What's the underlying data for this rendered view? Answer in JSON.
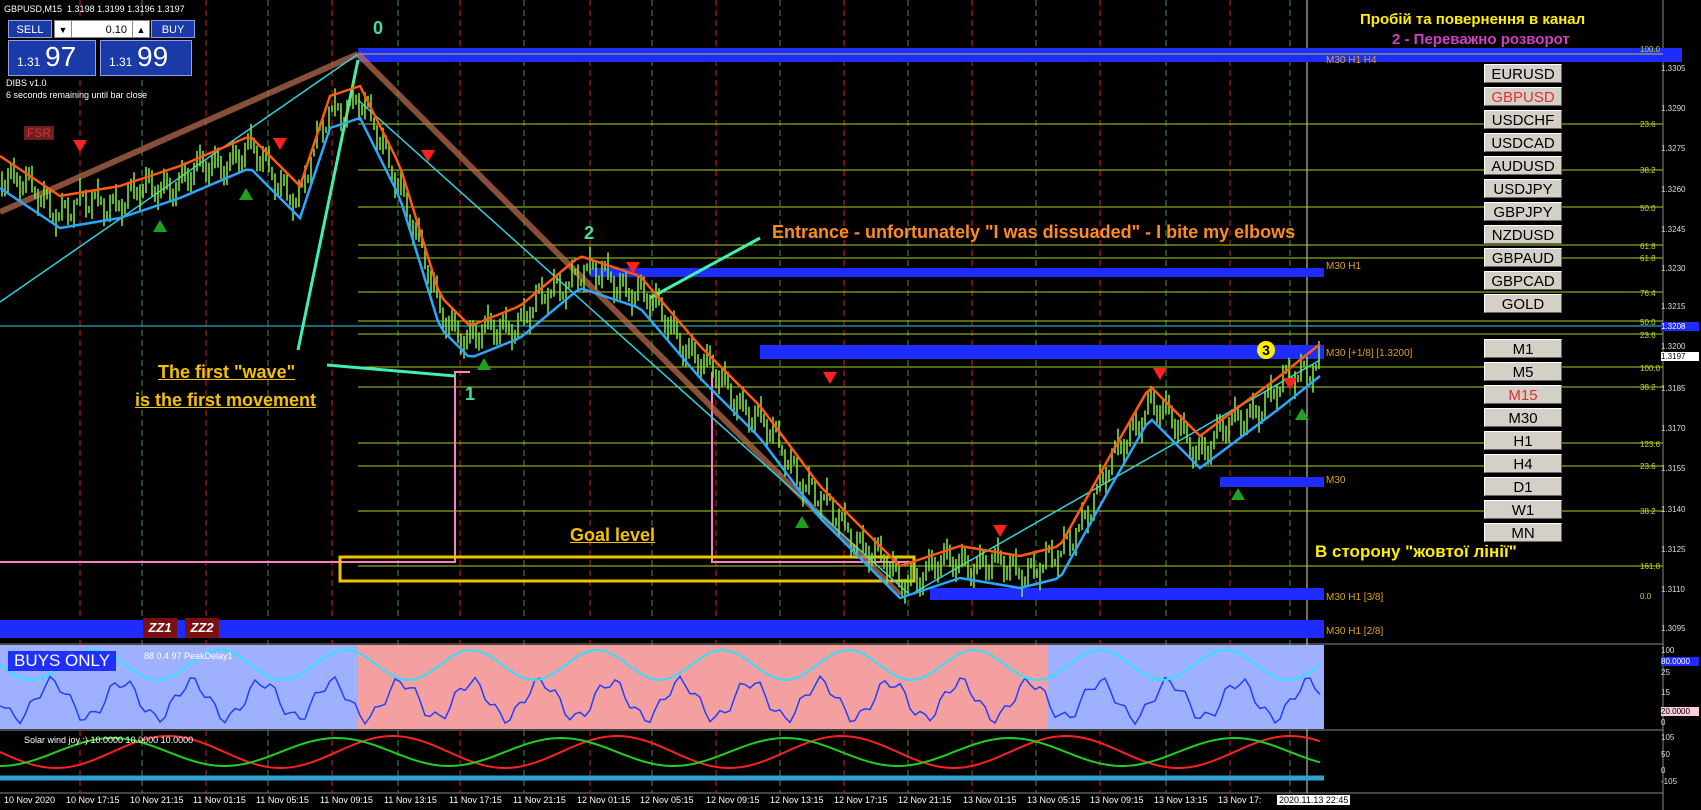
{
  "window": {
    "title": "GBPUSD,M15",
    "ohlc": "1.3198 1.3199 1.3196 1.3197"
  },
  "trade_panel": {
    "sell_label": "SELL",
    "buy_label": "BUY",
    "volume": "0.10",
    "sell_prefix": "1.31",
    "sell_big": "97",
    "buy_prefix": "1.31",
    "buy_big": "99"
  },
  "indicator_info": {
    "name": "DIBS v1.0",
    "timer": "6 seconds remaining until bar close",
    "fsr": "FSR"
  },
  "symbols": [
    "EURUSD",
    "GBPUSD",
    "USDCHF",
    "USDCAD",
    "AUDUSD",
    "USDJPY",
    "GBPJPY",
    "NZDUSD",
    "GBPAUD",
    "GBPCAD",
    "GOLD"
  ],
  "active_symbol": "GBPUSD",
  "timeframes": [
    "M1",
    "M5",
    "M15",
    "M30",
    "H1",
    "H4",
    "D1",
    "W1",
    "MN"
  ],
  "active_timeframe": "M15",
  "annotations": {
    "top_right_1": "Пробій та повернення в канал",
    "top_right_2": "2 - Переважно розворот",
    "entrance": "Entrance - unfortunately \"I was dissuaded\" - I bite my elbows",
    "first_wave_1": "The first \"wave\"",
    "first_wave_2": "is the first movement",
    "goal": "Goal level",
    "yellow_line": "В сторону \"жовтої лінії\"",
    "wave_0": "0",
    "wave_1": "1",
    "wave_2": "2",
    "wave_3": "3"
  },
  "level_labels": {
    "top": "M30 H1 H4",
    "h1": "M30 H1",
    "mid": "M30 [+1/8] [1.3200]",
    "m30": "M30",
    "low1": "M30 H1 [3/8]",
    "low2": "M30 H1 [2/8]"
  },
  "fib_labels": [
    "100.0",
    "23.6",
    "38.2",
    "50.0",
    "61.8",
    "61.8",
    "76.4",
    "50.0",
    "23.6",
    "100.0",
    "38.2",
    "123.6",
    "23.6",
    "38.2",
    "161.8",
    "0.0"
  ],
  "price_axis": [
    "1.3305",
    "1.3290",
    "1.3275",
    "1.3260",
    "1.3245",
    "1.3230",
    "1.3215",
    "1.3200",
    "1.3185",
    "1.3170",
    "1.3155",
    "1.3140",
    "1.3125",
    "1.3110",
    "1.3095"
  ],
  "current_price": "1.3197",
  "marker_price": "1.3208",
  "zz_buttons": [
    "ZZ1",
    "ZZ2"
  ],
  "osc1": {
    "badge": "BUYS ONLY",
    "params": "88 0.4 97  PeakDelay1",
    "levels": [
      "100",
      "80.0000",
      "25",
      "15",
      "20.0000",
      "0"
    ]
  },
  "osc2": {
    "title": "Solar wind joy :) 10.0000 10.0000 10.0000",
    "levels": [
      "105",
      "50",
      "0",
      "-105"
    ]
  },
  "time_axis": [
    "10 Nov 2020",
    "10 Nov 17:15",
    "10 Nov 21:15",
    "11 Nov 01:15",
    "11 Nov 05:15",
    "11 Nov 09:15",
    "11 Nov 13:15",
    "11 Nov 17:15",
    "11 Nov 21:15",
    "12 Nov 01:15",
    "12 Nov 05:15",
    "12 Nov 09:15",
    "12 Nov 13:15",
    "12 Nov 17:15",
    "12 Nov 21:15",
    "13 Nov 01:15",
    "13 Nov 05:15",
    "13 Nov 09:15",
    "13 Nov 13:15",
    "13 Nov 17:"
  ],
  "time_cursor": "2020.11.13 22:45",
  "colors": {
    "candle_bull": "#7ee040",
    "level_band": "#1f2cff",
    "fib_line": "#a8d420",
    "annotation_orange": "#ff8c1a",
    "annotation_gold": "#f2c200",
    "annotation_yellow": "#ffee00",
    "annotation_magenta": "#d040c0",
    "osc_red_zone": "#f4a0a0",
    "osc_blue_zone": "#9fb0ff"
  }
}
